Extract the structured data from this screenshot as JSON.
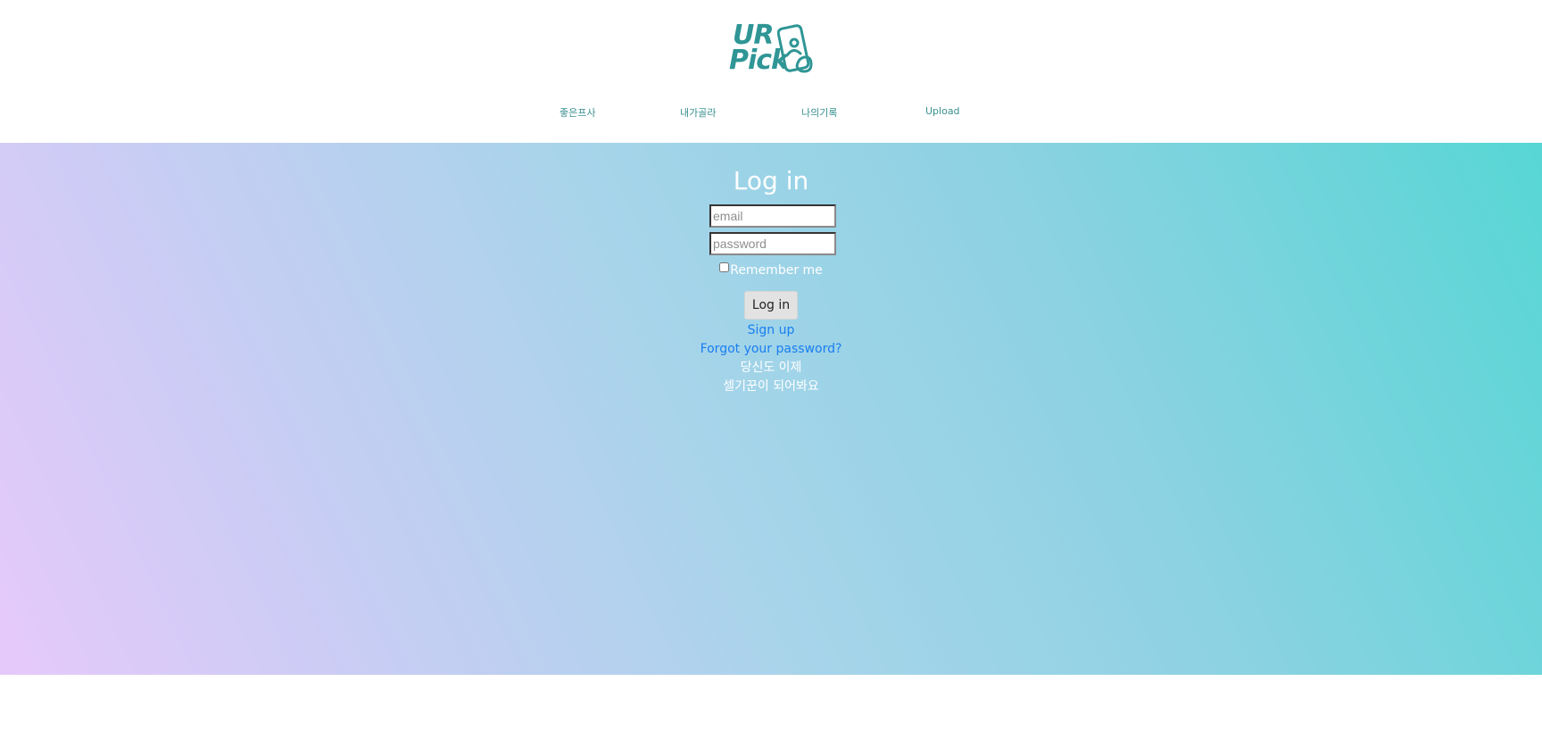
{
  "brand": {
    "logo_line1": "UR",
    "logo_line2": "Pick",
    "color": "#2f9595"
  },
  "nav": {
    "items": [
      {
        "label": "좋은프사"
      },
      {
        "label": "내가골라"
      },
      {
        "label": "나의기록"
      },
      {
        "label": "Upload"
      }
    ]
  },
  "login": {
    "title": "Log in",
    "email_placeholder": "email",
    "password_placeholder": "password",
    "remember_label": "Remember me",
    "submit_label": "Log in",
    "signup_link": "Sign up",
    "forgot_link": "Forgot your password?",
    "tagline_line1": "당신도 이제",
    "tagline_line2": "셀기꾼이 되어봐요"
  },
  "colors": {
    "accent": "#2f9595",
    "link": "#1a7ef0",
    "gradient_start": "#e6c9fb",
    "gradient_end": "#57d6d5"
  }
}
